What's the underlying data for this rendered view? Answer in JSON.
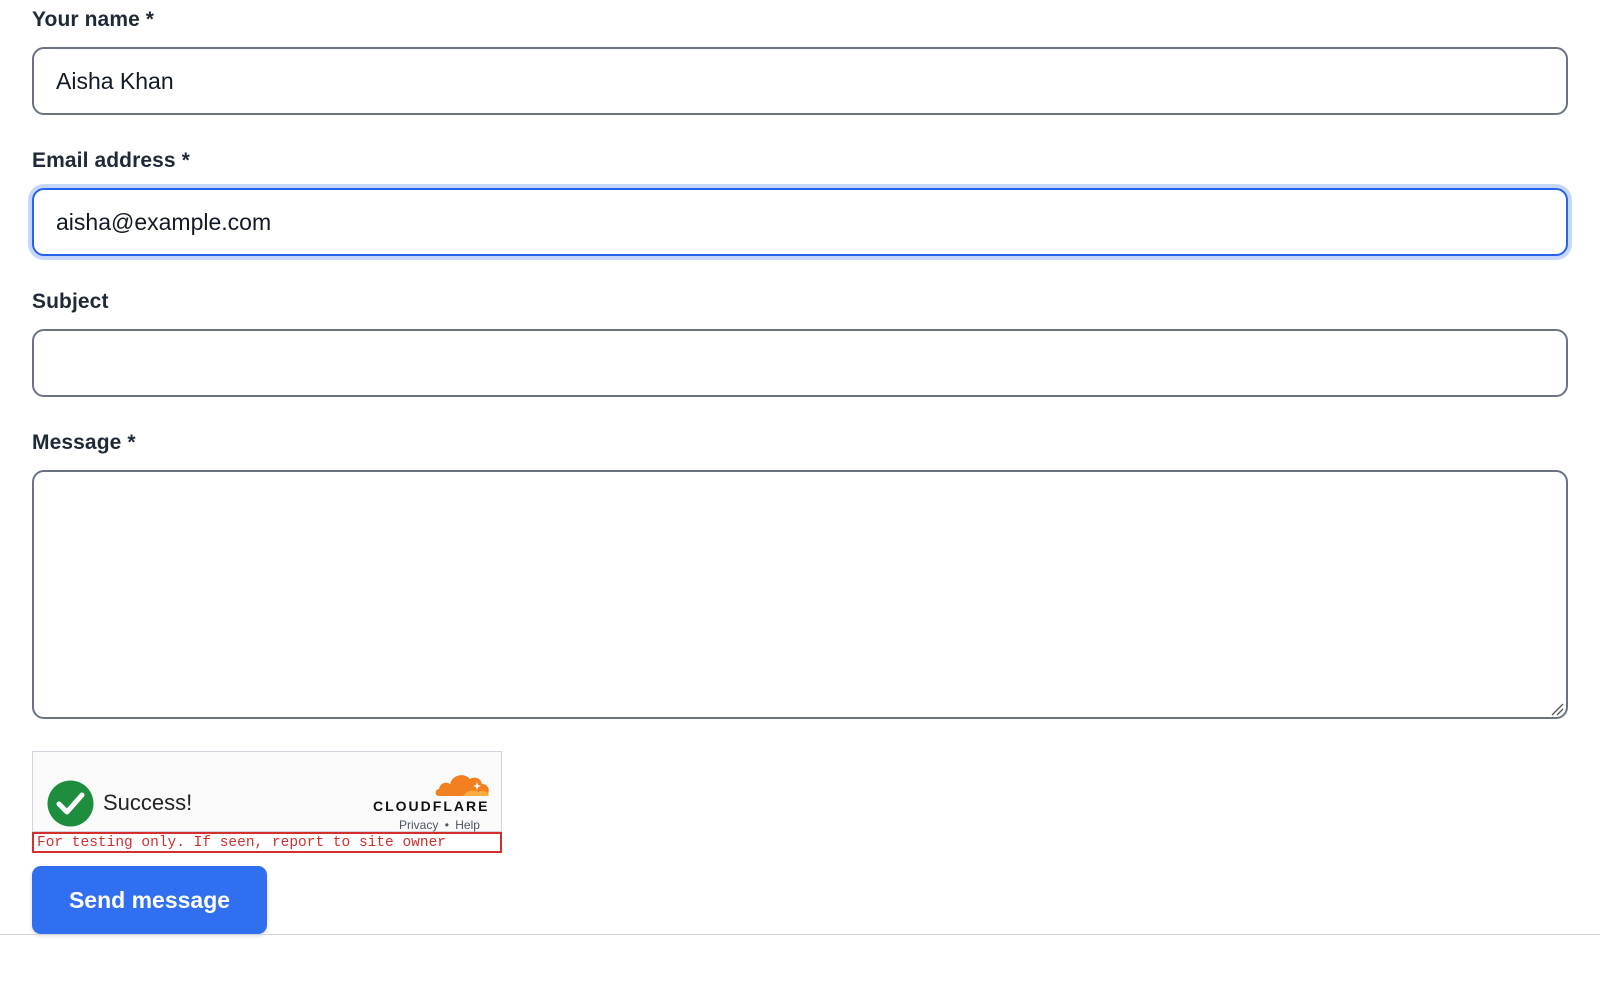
{
  "form": {
    "name": {
      "label": "Your name *",
      "value": "Aisha Khan"
    },
    "email": {
      "label": "Email address *",
      "value": "aisha@example.com",
      "focused": true
    },
    "subject": {
      "label": "Subject",
      "value": ""
    },
    "message": {
      "label": "Message *",
      "value": ""
    }
  },
  "turnstile": {
    "status_text": "Success!",
    "status_icon": "checkmark-circle-icon",
    "brand": "CLOUDFLARE",
    "privacy_link": "Privacy",
    "separator": "•",
    "help_link": "Help",
    "test_banner": "For testing only. If seen, report to site owner",
    "colors": {
      "success_green": "#1e8e3e",
      "brand_orange": "#f38020",
      "banner_red": "#d32f2f"
    }
  },
  "submit": {
    "label": "Send message",
    "color": "#2f6ff0"
  }
}
